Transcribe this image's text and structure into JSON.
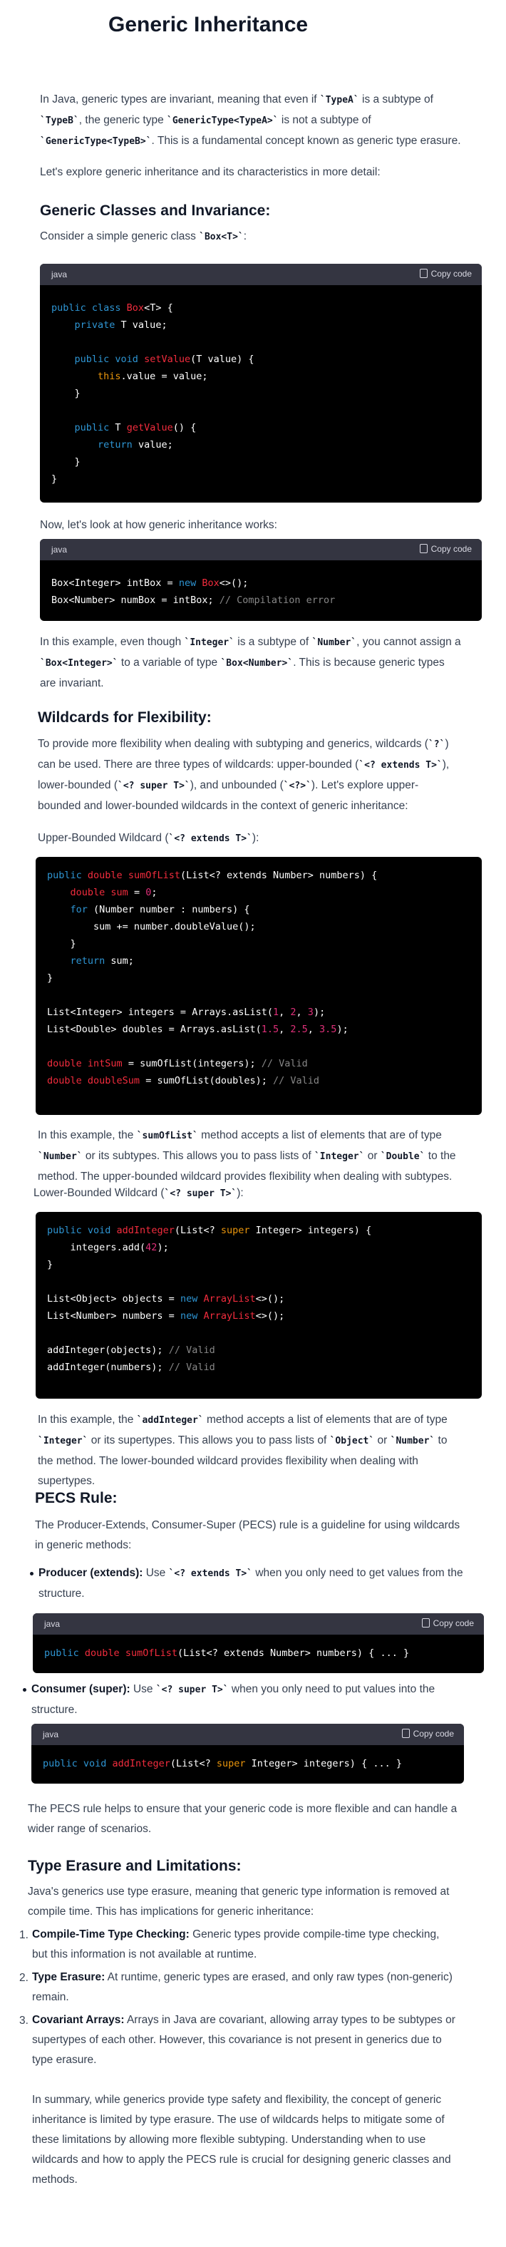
{
  "title": "Generic Inheritance",
  "intro": {
    "p1_a": "In Java, generic types are invariant, meaning that even if ",
    "p1_c1": "`TypeA`",
    "p1_b": " is a subtype of",
    "p1_c2": "`TypeB`",
    "p1_d": ", the generic type ",
    "p1_c3": "`GenericType<TypeA>`",
    "p1_e": " is not a subtype of",
    "p1_c4": "`GenericType<TypeB>`",
    "p1_f": ". This is a fundamental concept known as generic type erasure.",
    "p2": "Let's explore generic inheritance and its characteristics in more detail:"
  },
  "sec1": {
    "heading": "Generic Classes and Invariance:",
    "p_a": "Consider a simple generic class ",
    "p_c": "`Box<T>`",
    "p_b": ":",
    "lets_look": "Now, let's look at how generic inheritance works:",
    "expl_a": "In this example, even though ",
    "expl_c1": "`Integer`",
    "expl_b": " is a subtype of ",
    "expl_c2": "`Number`",
    "expl_d": ", you cannot assign a",
    "expl_c3": "`Box<Integer>`",
    "expl_e": " to a variable of type ",
    "expl_c4": "`Box<Number>`",
    "expl_f": ". This is because generic types",
    "expl_g": "are invariant."
  },
  "sec2": {
    "heading": "Wildcards for Flexibility:",
    "p1_a": "To provide more flexibility when dealing with subtyping and generics, wildcards (",
    "p1_c1": "`?`",
    "p1_b": ")",
    "p1_c": "can be used. There are three types of wildcards: upper-bounded (",
    "p1_c2": "`<? extends T>`",
    "p1_d": "),",
    "p1_e": "lower-bounded (",
    "p1_c3": "`<? super T>`",
    "p1_f": "), and unbounded (",
    "p1_c4": "`<?>`",
    "p1_g": "). Let's explore upper-",
    "p1_h": "bounded and lower-bounded wildcards in the context of generic inheritance:",
    "upper_label_a": "Upper-Bounded Wildcard (",
    "upper_label_c": "`<? extends T>`",
    "upper_label_b": "):",
    "upper_expl_a": "In this example, the ",
    "upper_expl_c1": "`sumOfList`",
    "upper_expl_b": " method accepts a list of elements that are of type",
    "upper_expl_c2": "`Number`",
    "upper_expl_c": " or its subtypes. This allows you to pass lists of ",
    "upper_expl_c3": "`Integer`",
    "upper_expl_d": " or ",
    "upper_expl_c4": "`Double`",
    "upper_expl_e": " to the",
    "upper_expl_f": "method. The upper-bounded wildcard provides flexibility when dealing with subtypes.",
    "lower_label_a": "Lower-Bounded Wildcard (",
    "lower_label_c": "`<? super T>`",
    "lower_label_b": "):",
    "lower_expl_a": "In this example, the ",
    "lower_expl_c1": "`addInteger`",
    "lower_expl_b": " method accepts a list of elements that are of type",
    "lower_expl_c2": "`Integer`",
    "lower_expl_c": " or its supertypes. This allows you to pass lists of ",
    "lower_expl_c3": "`Object`",
    "lower_expl_d": " or ",
    "lower_expl_c4": "`Number`",
    "lower_expl_e": " to",
    "lower_expl_f": "the method. The lower-bounded wildcard provides flexibility when dealing with",
    "lower_expl_g": "supertypes."
  },
  "sec3": {
    "heading": "PECS Rule:",
    "p1": "The Producer-Extends, Consumer-Super (PECS) rule is a guideline for using wildcards",
    "p1b": "in generic methods:",
    "b1_strong": "Producer (extends):",
    "b1_a": " Use ",
    "b1_c": "`<? extends T>`",
    "b1_b": " when you only need to get values from the",
    "b1_d": "structure.",
    "b2_strong": "Consumer (super):",
    "b2_a": " Use ",
    "b2_c": "`<? super T>`",
    "b2_b": " when you only need to put values into the",
    "b2_d": "structure.",
    "p2": "The PECS rule helps to ensure that your generic code is more flexible and can handle a",
    "p2b": "wider range of scenarios."
  },
  "sec4": {
    "heading": "Type Erasure and Limitations:",
    "p1": "Java's generics use type erasure, meaning that generic type information is removed at",
    "p1b": "compile time. This has implications for generic inheritance:",
    "items": [
      {
        "n": "1.",
        "strong": "Compile-Time Type Checking:",
        "text": " Generic types provide compile-time type checking,",
        "text2": "but this information is not available at runtime."
      },
      {
        "n": "2.",
        "strong": "Type Erasure:",
        "text": " At runtime, generic types are erased, and only raw types (non-generic)",
        "text2": "remain."
      },
      {
        "n": "3.",
        "strong": "Covariant Arrays:",
        "text": " Arrays in Java are covariant, allowing array types to be subtypes or",
        "text2": "supertypes of each other. However, this covariance is not present in generics due to",
        "text3": "type erasure."
      }
    ],
    "summary": [
      "In summary, while generics provide type safety and flexibility, the concept of generic",
      "inheritance is limited by type erasure. The use of wildcards helps to mitigate some of",
      "these limitations by allowing more flexible subtyping. Understanding when to use",
      "wildcards and how to apply the PECS rule is crucial for designing generic classes and",
      "methods."
    ]
  },
  "code_ui": {
    "lang": "java",
    "copy": "Copy code"
  },
  "code": {
    "box_class": [
      [
        [
          "kw",
          "public class "
        ],
        [
          "fn",
          "Box"
        ],
        [
          "",
          "<T> {"
        ]
      ],
      [
        [
          "",
          "    "
        ],
        [
          "kw",
          "private "
        ],
        [
          "",
          "T value;"
        ]
      ],
      [
        [
          "",
          ""
        ]
      ],
      [
        [
          "",
          "    "
        ],
        [
          "kw",
          "public void "
        ],
        [
          "fn",
          "setValue"
        ],
        [
          "",
          "(T value) {"
        ]
      ],
      [
        [
          "",
          "        "
        ],
        [
          "th",
          "this"
        ],
        [
          "",
          ".value = value;"
        ]
      ],
      [
        [
          "",
          "    }"
        ]
      ],
      [
        [
          "",
          ""
        ]
      ],
      [
        [
          "",
          "    "
        ],
        [
          "kw",
          "public "
        ],
        [
          "",
          "T "
        ],
        [
          "fn",
          "getValue"
        ],
        [
          "",
          "() {"
        ]
      ],
      [
        [
          "",
          "        "
        ],
        [
          "kw",
          "return "
        ],
        [
          "",
          "value;"
        ]
      ],
      [
        [
          "",
          "    }"
        ]
      ],
      [
        [
          "",
          "}"
        ]
      ]
    ],
    "box_assign": [
      [
        [
          "",
          "Box<Integer> intBox = "
        ],
        [
          "kw",
          "new "
        ],
        [
          "fn",
          "Box"
        ],
        [
          "",
          "<>();"
        ]
      ],
      [
        [
          "",
          "Box<Number> numBox = intBox; "
        ],
        [
          "cm",
          "// Compilation error"
        ]
      ]
    ],
    "upper": [
      [
        [
          "kw",
          "public "
        ],
        [
          "fn",
          "double "
        ],
        [
          "fn",
          "sumOfList"
        ],
        [
          "",
          "(List<? extends Number> numbers) {"
        ]
      ],
      [
        [
          "",
          "    "
        ],
        [
          "fn",
          "double "
        ],
        [
          "fn",
          "sum "
        ],
        [
          "",
          "= "
        ],
        [
          "nm",
          "0"
        ],
        [
          "",
          ";"
        ]
      ],
      [
        [
          "",
          "    "
        ],
        [
          "kw",
          "for "
        ],
        [
          "",
          "(Number number : numbers) {"
        ]
      ],
      [
        [
          "",
          "        sum += number.doubleValue();"
        ]
      ],
      [
        [
          "",
          "    }"
        ]
      ],
      [
        [
          "",
          "    "
        ],
        [
          "kw",
          "return "
        ],
        [
          "",
          "sum;"
        ]
      ],
      [
        [
          "",
          "}"
        ]
      ],
      [
        [
          "",
          ""
        ]
      ],
      [
        [
          "",
          "List<Integer> integers = Arrays.asList("
        ],
        [
          "nm",
          "1"
        ],
        [
          "",
          ", "
        ],
        [
          "nm",
          "2"
        ],
        [
          "",
          ", "
        ],
        [
          "nm",
          "3"
        ],
        [
          "",
          ");"
        ]
      ],
      [
        [
          "",
          "List<Double> doubles = Arrays.asList("
        ],
        [
          "nm",
          "1.5"
        ],
        [
          "",
          ", "
        ],
        [
          "nm",
          "2.5"
        ],
        [
          "",
          ", "
        ],
        [
          "nm",
          "3.5"
        ],
        [
          "",
          ");"
        ]
      ],
      [
        [
          "",
          ""
        ]
      ],
      [
        [
          "fn",
          "double "
        ],
        [
          "fn",
          "intSum "
        ],
        [
          "",
          "= sumOfList(integers); "
        ],
        [
          "cm",
          "// Valid"
        ]
      ],
      [
        [
          "fn",
          "double "
        ],
        [
          "fn",
          "doubleSum "
        ],
        [
          "",
          "= sumOfList(doubles); "
        ],
        [
          "cm",
          "// Valid"
        ]
      ]
    ],
    "lower": [
      [
        [
          "kw",
          "public void "
        ],
        [
          "fn",
          "addInteger"
        ],
        [
          "",
          "(List<? "
        ],
        [
          "th",
          "super "
        ],
        [
          "",
          "Integer> integers) {"
        ]
      ],
      [
        [
          "",
          "    integers.add("
        ],
        [
          "nm",
          "42"
        ],
        [
          "",
          ");"
        ]
      ],
      [
        [
          "",
          "}"
        ]
      ],
      [
        [
          "",
          ""
        ]
      ],
      [
        [
          "",
          "List<Object> objects = "
        ],
        [
          "kw",
          "new "
        ],
        [
          "fn",
          "ArrayList"
        ],
        [
          "",
          "<>();"
        ]
      ],
      [
        [
          "",
          "List<Number> numbers = "
        ],
        [
          "kw",
          "new "
        ],
        [
          "fn",
          "ArrayList"
        ],
        [
          "",
          "<>();"
        ]
      ],
      [
        [
          "",
          ""
        ]
      ],
      [
        [
          "",
          "addInteger(objects); "
        ],
        [
          "cm",
          "// Valid"
        ]
      ],
      [
        [
          "",
          "addInteger(numbers); "
        ],
        [
          "cm",
          "// Valid"
        ]
      ]
    ],
    "pecs_extends": [
      [
        [
          "kw",
          "public "
        ],
        [
          "fn",
          "double "
        ],
        [
          "fn",
          "sumOfList"
        ],
        [
          "",
          "(List<? extends Number> numbers) { ... }"
        ]
      ]
    ],
    "pecs_super": [
      [
        [
          "kw",
          "public void "
        ],
        [
          "fn",
          "addInteger"
        ],
        [
          "",
          "(List<? "
        ],
        [
          "th",
          "super "
        ],
        [
          "",
          "Integer> integers) { ... }"
        ]
      ]
    ]
  }
}
